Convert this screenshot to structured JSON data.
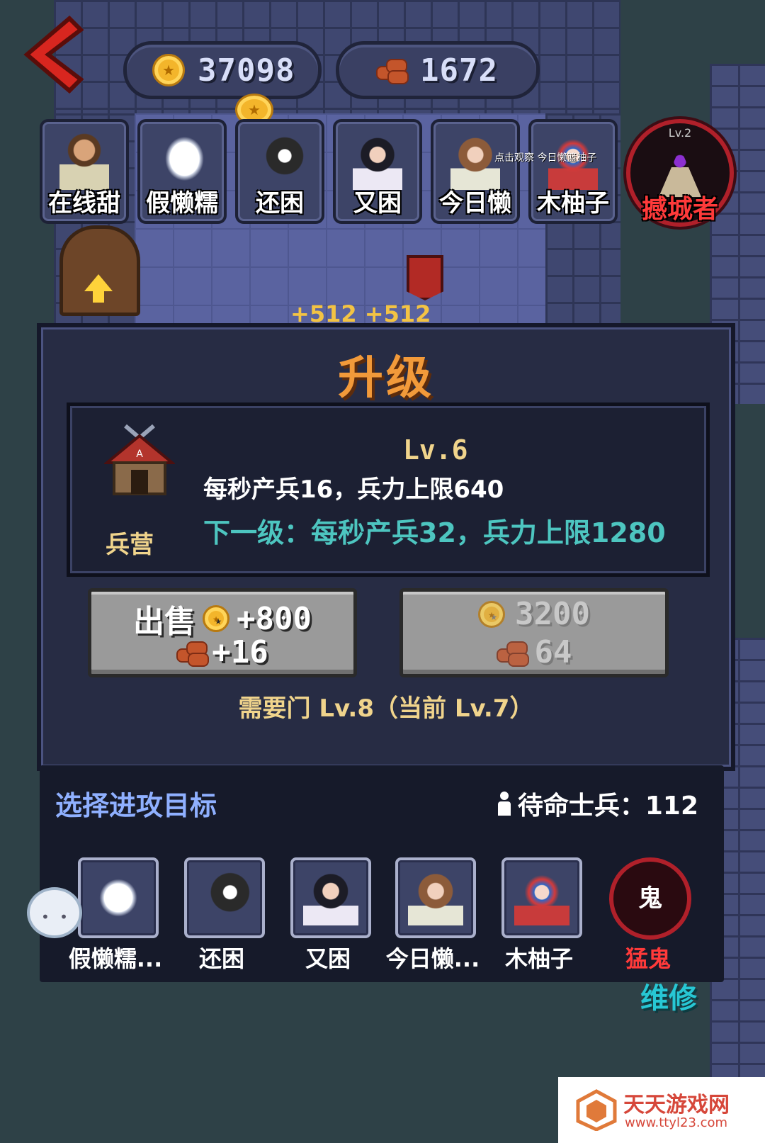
{
  "topbar": {
    "gold": "37098",
    "wood": "1672"
  },
  "players": [
    {
      "name": "在线甜",
      "icon": "bearded-man-avatar"
    },
    {
      "name": "假懒糯",
      "icon": "white-dog-avatar"
    },
    {
      "name": "还困",
      "icon": "black-cat-avatar"
    },
    {
      "name": "又困",
      "icon": "girl-butterfly-avatar"
    },
    {
      "name": "今日懒",
      "icon": "brown-hair-girl-avatar"
    },
    {
      "name": "木柚子",
      "icon": "opera-girl-avatar"
    }
  ],
  "boss": {
    "level": "Lv.2",
    "name": "撼城者"
  },
  "floating_text": "+512 +512",
  "overlay_tip": "点击观察 今日懒篮柚子",
  "upgrade": {
    "title": "升级",
    "building_name": "兵营",
    "level": "Lv.6",
    "current": "每秒产兵16，兵力上限640",
    "next": "下一级：每秒产兵32，兵力上限1280",
    "sell_label": "出售",
    "sell_gold": "+800",
    "sell_wood": "+16",
    "upgrade_gold": "3200",
    "upgrade_wood": "64",
    "requirement": "需要门 Lv.8（当前 Lv.7）"
  },
  "targets": {
    "title": "选择进攻目标",
    "soldiers_label": "待命士兵：112",
    "list": [
      {
        "name": "假懒糯...",
        "icon": "white-dog-avatar"
      },
      {
        "name": "还困",
        "icon": "black-cat-avatar"
      },
      {
        "name": "又困",
        "icon": "girl-butterfly-avatar"
      },
      {
        "name": "今日懒...",
        "icon": "brown-hair-girl-avatar"
      },
      {
        "name": "木柚子",
        "icon": "opera-girl-avatar"
      }
    ],
    "ghost_glyph": "鬼",
    "ghost_name": "猛鬼"
  },
  "repair_label": "维修",
  "watermark": {
    "title": "天天游戏网",
    "url": "www.ttyl23.com"
  },
  "colors": {
    "title_orange": "#f29a3a",
    "next_level_cyan": "#4dc5c0",
    "boss_red": "#ff3a3a",
    "gold_text": "#f0d48c"
  }
}
